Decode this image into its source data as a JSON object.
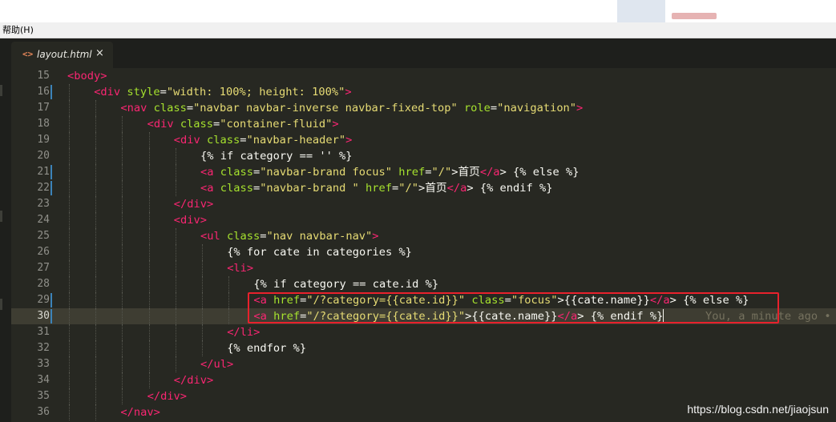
{
  "menubar": {
    "help_label": "帮助(H)"
  },
  "tab": {
    "icon": "<>",
    "filename": "layout.html",
    "close": "×"
  },
  "editor": {
    "lines": [
      {
        "n": "15",
        "indent": 0,
        "tokens": [
          [
            "t",
            "<body"
          ],
          [
            "t",
            ">"
          ]
        ]
      },
      {
        "n": "16",
        "indent": 1,
        "mark": true,
        "tokens": [
          [
            "t",
            "<div"
          ],
          [
            "p",
            " "
          ],
          [
            "a",
            "style"
          ],
          [
            "p",
            "="
          ],
          [
            "s",
            "\"width: 100%; height: 100%\""
          ],
          [
            "t",
            ">"
          ]
        ]
      },
      {
        "n": "17",
        "indent": 2,
        "tokens": [
          [
            "t",
            "<nav"
          ],
          [
            "p",
            " "
          ],
          [
            "a",
            "class"
          ],
          [
            "p",
            "="
          ],
          [
            "s",
            "\"navbar navbar-inverse navbar-fixed-top\""
          ],
          [
            "p",
            " "
          ],
          [
            "a",
            "role"
          ],
          [
            "p",
            "="
          ],
          [
            "s",
            "\"navigation\""
          ],
          [
            "t",
            ">"
          ]
        ]
      },
      {
        "n": "18",
        "indent": 3,
        "tokens": [
          [
            "t",
            "<div"
          ],
          [
            "p",
            " "
          ],
          [
            "a",
            "class"
          ],
          [
            "p",
            "="
          ],
          [
            "s",
            "\"container-fluid\""
          ],
          [
            "t",
            ">"
          ]
        ]
      },
      {
        "n": "19",
        "indent": 4,
        "tokens": [
          [
            "t",
            "<div"
          ],
          [
            "p",
            " "
          ],
          [
            "a",
            "class"
          ],
          [
            "p",
            "="
          ],
          [
            "s",
            "\"navbar-header\""
          ],
          [
            "t",
            ">"
          ]
        ]
      },
      {
        "n": "20",
        "indent": 5,
        "tokens": [
          [
            "p",
            "{% if category == '' %}"
          ]
        ]
      },
      {
        "n": "21",
        "indent": 5,
        "mark": true,
        "tokens": [
          [
            "t",
            "<a"
          ],
          [
            "p",
            " "
          ],
          [
            "a",
            "class"
          ],
          [
            "p",
            "="
          ],
          [
            "s",
            "\"navbar-brand focus\""
          ],
          [
            "p",
            " "
          ],
          [
            "a",
            "href"
          ],
          [
            "p",
            "="
          ],
          [
            "s",
            "\"/\""
          ],
          [
            "p",
            ">首页"
          ],
          [
            "t",
            "</a"
          ],
          [
            "p",
            "> {% else %}"
          ]
        ]
      },
      {
        "n": "22",
        "indent": 5,
        "mark": true,
        "tokens": [
          [
            "t",
            "<a"
          ],
          [
            "p",
            " "
          ],
          [
            "a",
            "class"
          ],
          [
            "p",
            "="
          ],
          [
            "s",
            "\"navbar-brand \""
          ],
          [
            "p",
            " "
          ],
          [
            "a",
            "href"
          ],
          [
            "p",
            "="
          ],
          [
            "s",
            "\"/\""
          ],
          [
            "p",
            ">首页"
          ],
          [
            "t",
            "</a"
          ],
          [
            "p",
            "> {% endif %}"
          ]
        ]
      },
      {
        "n": "23",
        "indent": 4,
        "tokens": [
          [
            "t",
            "</div"
          ],
          [
            "t",
            ">"
          ]
        ]
      },
      {
        "n": "24",
        "indent": 4,
        "tokens": [
          [
            "t",
            "<div"
          ],
          [
            "t",
            ">"
          ]
        ]
      },
      {
        "n": "25",
        "indent": 5,
        "tokens": [
          [
            "t",
            "<ul"
          ],
          [
            "p",
            " "
          ],
          [
            "a",
            "class"
          ],
          [
            "p",
            "="
          ],
          [
            "s",
            "\"nav navbar-nav\""
          ],
          [
            "t",
            ">"
          ]
        ]
      },
      {
        "n": "26",
        "indent": 6,
        "tokens": [
          [
            "p",
            "{% for cate in categories %}"
          ]
        ]
      },
      {
        "n": "27",
        "indent": 6,
        "tokens": [
          [
            "t",
            "<li"
          ],
          [
            "t",
            ">"
          ]
        ]
      },
      {
        "n": "28",
        "indent": 7,
        "tokens": [
          [
            "p",
            "{% if category == cate.id %}"
          ]
        ]
      },
      {
        "n": "29",
        "indent": 7,
        "mark": true,
        "tokens": [
          [
            "t",
            "<a"
          ],
          [
            "p",
            " "
          ],
          [
            "a",
            "href"
          ],
          [
            "p",
            "="
          ],
          [
            "s",
            "\"/?category={{cate.id}}\""
          ],
          [
            "p",
            " "
          ],
          [
            "a",
            "class"
          ],
          [
            "p",
            "="
          ],
          [
            "s",
            "\"focus\""
          ],
          [
            "p",
            ">{{cate.name}}"
          ],
          [
            "t",
            "</a"
          ],
          [
            "p",
            "> {% else %}"
          ]
        ]
      },
      {
        "n": "30",
        "indent": 7,
        "mark": true,
        "active": true,
        "tokens": [
          [
            "t",
            "<a"
          ],
          [
            "p",
            " "
          ],
          [
            "a",
            "href"
          ],
          [
            "p",
            "="
          ],
          [
            "s",
            "\"/?category={{cate.id}}\""
          ],
          [
            "p",
            ">{{cate.name}}"
          ],
          [
            "t",
            "</a"
          ],
          [
            "p",
            "> {% endif %}"
          ]
        ],
        "blame": "You, a minute ago •"
      },
      {
        "n": "31",
        "indent": 6,
        "tokens": [
          [
            "t",
            "</li"
          ],
          [
            "t",
            ">"
          ]
        ]
      },
      {
        "n": "32",
        "indent": 6,
        "tokens": [
          [
            "p",
            "{% endfor %}"
          ]
        ]
      },
      {
        "n": "33",
        "indent": 5,
        "tokens": [
          [
            "t",
            "</ul"
          ],
          [
            "t",
            ">"
          ]
        ]
      },
      {
        "n": "34",
        "indent": 4,
        "tokens": [
          [
            "t",
            "</div"
          ],
          [
            "t",
            ">"
          ]
        ]
      },
      {
        "n": "35",
        "indent": 3,
        "tokens": [
          [
            "t",
            "</div"
          ],
          [
            "t",
            ">"
          ]
        ]
      },
      {
        "n": "36",
        "indent": 2,
        "tokens": [
          [
            "t",
            "</nav"
          ],
          [
            "t",
            ">"
          ]
        ]
      }
    ]
  },
  "watermark": "https://blog.csdn.net/jiaojsun",
  "colors": {
    "background": "#272822",
    "tag": "#f92672",
    "attribute": "#a6e22e",
    "string": "#e6db74",
    "text": "#f8f8f2",
    "highlight_box": "#e8212c"
  }
}
